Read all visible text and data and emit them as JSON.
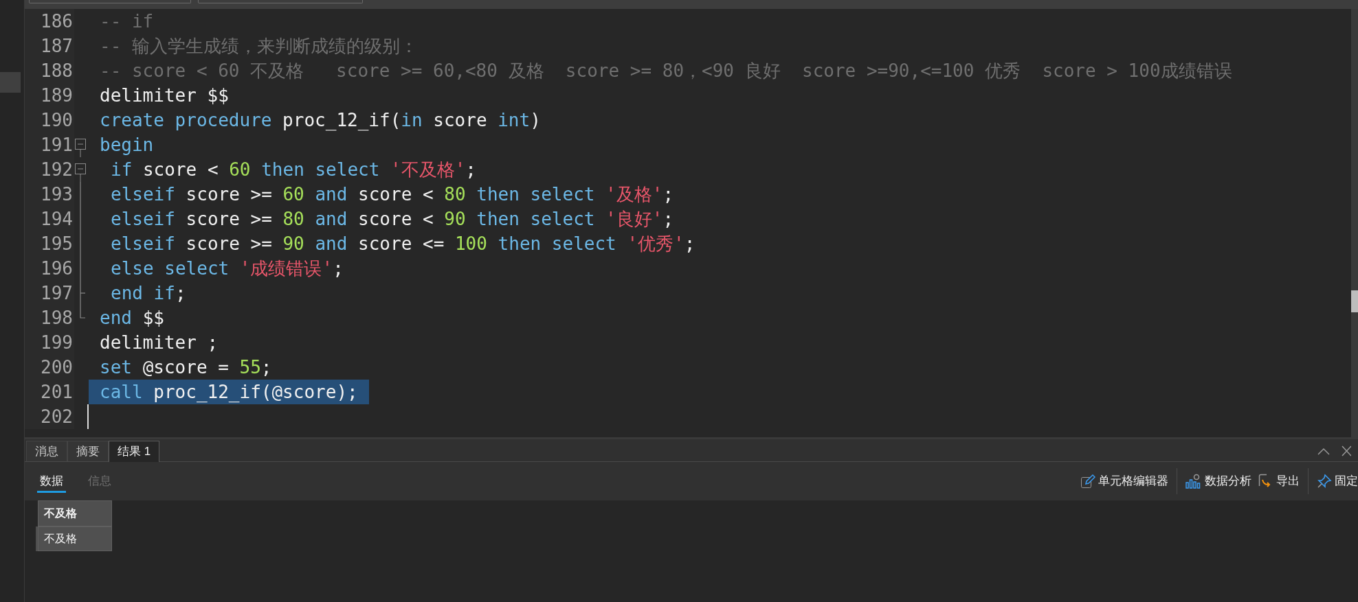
{
  "editor": {
    "lines": [
      {
        "number": "186",
        "kind": "code",
        "tokens": [
          {
            "kind": "comment",
            "text": "-- if"
          }
        ]
      },
      {
        "number": "187",
        "kind": "code",
        "tokens": [
          {
            "kind": "comment",
            "text": "-- 输入学生成绩，来判断成绩的级别："
          }
        ]
      },
      {
        "number": "188",
        "kind": "code",
        "tokens": [
          {
            "kind": "comment",
            "text": "-- score < 60 不及格   score >= 60,<80 及格  score >= 80，<90 良好  score >=90,<=100 优秀  score > 100成绩错误"
          }
        ]
      },
      {
        "number": "189",
        "kind": "code",
        "tokens": [
          {
            "kind": "plain",
            "text": "delimiter $$"
          }
        ]
      },
      {
        "number": "190",
        "kind": "code",
        "tokens": [
          {
            "kind": "keyword",
            "text": "create procedure "
          },
          {
            "kind": "plain",
            "text": "proc_12_if("
          },
          {
            "kind": "keyword",
            "text": "in "
          },
          {
            "kind": "plain",
            "text": "score "
          },
          {
            "kind": "keyword",
            "text": "int"
          },
          {
            "kind": "plain",
            "text": ")"
          }
        ]
      },
      {
        "number": "191",
        "kind": "start",
        "tokens": [
          {
            "kind": "keyword",
            "text": "begin"
          }
        ]
      },
      {
        "number": "192",
        "kind": "start",
        "indent": true,
        "tokens": [
          {
            "kind": "keyword",
            "text": "if "
          },
          {
            "kind": "plain",
            "text": "score < "
          },
          {
            "kind": "number",
            "text": "60 "
          },
          {
            "kind": "keyword",
            "text": "then select "
          },
          {
            "kind": "string",
            "text": "'不及格'"
          },
          {
            "kind": "plain",
            "text": ";"
          }
        ]
      },
      {
        "number": "193",
        "kind": "guide",
        "indent": true,
        "tokens": [
          {
            "kind": "keyword",
            "text": "elseif "
          },
          {
            "kind": "plain",
            "text": "score >= "
          },
          {
            "kind": "number",
            "text": "60 "
          },
          {
            "kind": "keyword",
            "text": "and "
          },
          {
            "kind": "plain",
            "text": "score < "
          },
          {
            "kind": "number",
            "text": "80 "
          },
          {
            "kind": "keyword",
            "text": "then select "
          },
          {
            "kind": "string",
            "text": "'及格'"
          },
          {
            "kind": "plain",
            "text": ";"
          }
        ]
      },
      {
        "number": "194",
        "kind": "guide",
        "indent": true,
        "tokens": [
          {
            "kind": "keyword",
            "text": "elseif "
          },
          {
            "kind": "plain",
            "text": "score >= "
          },
          {
            "kind": "number",
            "text": "80 "
          },
          {
            "kind": "keyword",
            "text": "and "
          },
          {
            "kind": "plain",
            "text": "score < "
          },
          {
            "kind": "number",
            "text": "90 "
          },
          {
            "kind": "keyword",
            "text": "then select "
          },
          {
            "kind": "string",
            "text": "'良好'"
          },
          {
            "kind": "plain",
            "text": ";"
          }
        ]
      },
      {
        "number": "195",
        "kind": "guide",
        "indent": true,
        "tokens": [
          {
            "kind": "keyword",
            "text": "elseif "
          },
          {
            "kind": "plain",
            "text": "score >= "
          },
          {
            "kind": "number",
            "text": "90 "
          },
          {
            "kind": "keyword",
            "text": "and "
          },
          {
            "kind": "plain",
            "text": "score <= "
          },
          {
            "kind": "number",
            "text": "100 "
          },
          {
            "kind": "keyword",
            "text": "then select "
          },
          {
            "kind": "string",
            "text": "'优秀'"
          },
          {
            "kind": "plain",
            "text": ";"
          }
        ]
      },
      {
        "number": "196",
        "kind": "guide",
        "indent": true,
        "tokens": [
          {
            "kind": "keyword",
            "text": "else select "
          },
          {
            "kind": "string",
            "text": "'成绩错误'"
          },
          {
            "kind": "plain",
            "text": ";"
          }
        ]
      },
      {
        "number": "197",
        "kind": "close",
        "indent": true,
        "tokens": [
          {
            "kind": "keyword",
            "text": "end if"
          },
          {
            "kind": "plain",
            "text": ";"
          }
        ]
      },
      {
        "number": "198",
        "kind": "end",
        "tokens": [
          {
            "kind": "keyword",
            "text": "end "
          },
          {
            "kind": "plain",
            "text": "$$"
          }
        ]
      },
      {
        "number": "199",
        "kind": "code",
        "tokens": [
          {
            "kind": "plain",
            "text": "delimiter ;"
          }
        ]
      },
      {
        "number": "200",
        "kind": "code",
        "tokens": [
          {
            "kind": "keyword",
            "text": "set "
          },
          {
            "kind": "plain",
            "text": "@score = "
          },
          {
            "kind": "number",
            "text": "55"
          },
          {
            "kind": "plain",
            "text": ";"
          }
        ]
      },
      {
        "number": "201",
        "kind": "code",
        "selected": true,
        "tokens": [
          {
            "kind": "keyword",
            "text": "call "
          },
          {
            "kind": "plain",
            "text": "proc_12_if(@score);"
          }
        ]
      },
      {
        "number": "202",
        "kind": "code",
        "caret": true
      }
    ]
  },
  "result_panel": {
    "tabs": [
      {
        "label": "消息",
        "selected": false
      },
      {
        "label": "摘要",
        "selected": false
      },
      {
        "label": "结果 1",
        "selected": true
      }
    ],
    "subtabs": [
      {
        "label": "数据",
        "selected": true
      },
      {
        "label": "信息",
        "selected": false
      }
    ],
    "toolbar": [
      {
        "kind": "pencil",
        "label": "单元格编辑器"
      },
      {
        "kind": "analysis",
        "label": "数据分析"
      },
      {
        "kind": "export",
        "label": "导出"
      },
      {
        "kind": "pin",
        "label": "固定"
      }
    ],
    "table": {
      "columns": [
        "不及格"
      ],
      "rows": [
        [
          "不及格"
        ]
      ]
    }
  }
}
